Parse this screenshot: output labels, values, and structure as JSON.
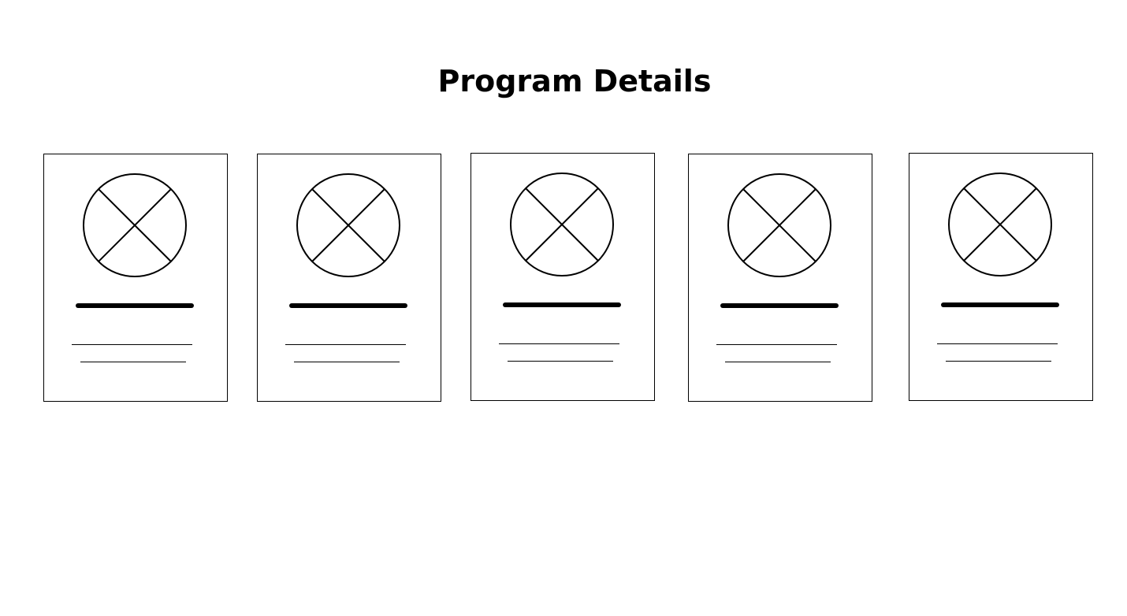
{
  "page": {
    "title": "Program Details"
  },
  "cards": [
    {
      "image_icon": "image-placeholder-icon"
    },
    {
      "image_icon": "image-placeholder-icon"
    },
    {
      "image_icon": "image-placeholder-icon"
    },
    {
      "image_icon": "image-placeholder-icon"
    },
    {
      "image_icon": "image-placeholder-icon"
    }
  ]
}
